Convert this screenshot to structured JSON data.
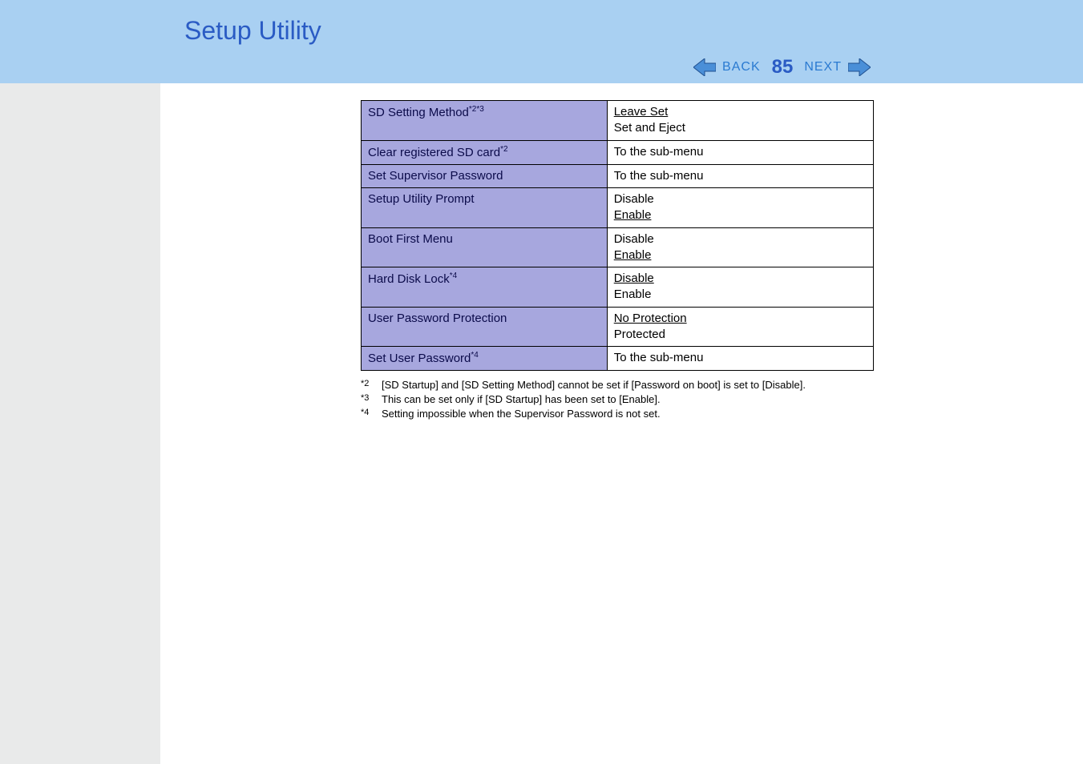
{
  "header": {
    "title": "Setup Utility"
  },
  "nav": {
    "back_label": "BACK",
    "page_number": "85",
    "next_label": "NEXT"
  },
  "table": {
    "rows": [
      {
        "label": "SD Setting Method",
        "sup": "*2*3",
        "value_lines": [
          "Leave Set",
          "Set and Eject"
        ],
        "underline_idx": 0
      },
      {
        "label": "Clear registered SD card",
        "sup": "*2",
        "value_lines": [
          "To the sub-menu"
        ],
        "underline_idx": -1
      },
      {
        "label": "Set Supervisor Password",
        "sup": "",
        "value_lines": [
          "To the sub-menu"
        ],
        "underline_idx": -1
      },
      {
        "label": "Setup Utility Prompt",
        "sup": "",
        "value_lines": [
          "Disable",
          "Enable"
        ],
        "underline_idx": 1
      },
      {
        "label": "Boot First Menu",
        "sup": "",
        "value_lines": [
          "Disable",
          "Enable"
        ],
        "underline_idx": 1
      },
      {
        "label": "Hard Disk Lock",
        "sup": "*4",
        "value_lines": [
          "Disable",
          "Enable"
        ],
        "underline_idx": 0
      },
      {
        "label": "User Password Protection",
        "sup": "",
        "value_lines": [
          "No Protection",
          "Protected"
        ],
        "underline_idx": 0
      },
      {
        "label": "Set User Password",
        "sup": "*4",
        "value_lines": [
          "To the sub-menu"
        ],
        "underline_idx": -1
      }
    ]
  },
  "footnotes": [
    {
      "mark": "*2",
      "text": "[SD Startup] and [SD Setting Method] cannot be set if [Password on boot] is set to [Disable]."
    },
    {
      "mark": "*3",
      "text": "This can be set only if [SD Startup] has been set to [Enable]."
    },
    {
      "mark": "*4",
      "text": "Setting impossible when the Supervisor Password is not set."
    }
  ]
}
